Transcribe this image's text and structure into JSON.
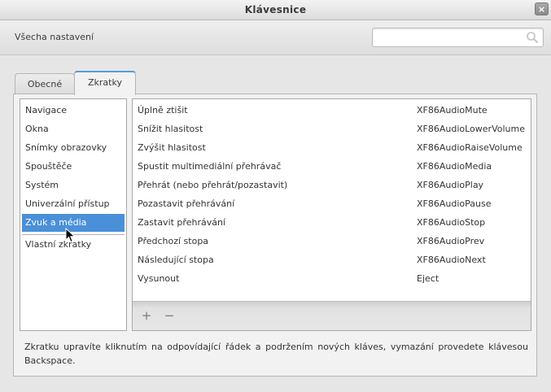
{
  "window": {
    "title": "Klávesnice",
    "close_glyph": "×"
  },
  "header": {
    "back_label": "Všecha nastavení",
    "search_placeholder": ""
  },
  "tabs": [
    {
      "label": "Obecné"
    },
    {
      "label": "Zkratky"
    }
  ],
  "categories": [
    {
      "label": "Navigace"
    },
    {
      "label": "Okna"
    },
    {
      "label": "Snímky obrazovky"
    },
    {
      "label": "Spouštěče"
    },
    {
      "label": "Systém"
    },
    {
      "label": "Univerzální přístup"
    },
    {
      "label": "Zvuk a média"
    },
    {
      "label": "Vlastní zkratky"
    }
  ],
  "selected_category": "Zvuk a média",
  "shortcuts": [
    {
      "name": "Úplně ztišit",
      "key": "XF86AudioMute"
    },
    {
      "name": "Snížit hlasitost",
      "key": "XF86AudioLowerVolume"
    },
    {
      "name": "Zvýšit hlasitost",
      "key": "XF86AudioRaiseVolume"
    },
    {
      "name": "Spustit multimediální přehrávač",
      "key": "XF86AudioMedia"
    },
    {
      "name": "Přehrát (nebo přehrát/pozastavit)",
      "key": "XF86AudioPlay"
    },
    {
      "name": "Pozastavit přehrávání",
      "key": "XF86AudioPause"
    },
    {
      "name": "Zastavit přehrávání",
      "key": "XF86AudioStop"
    },
    {
      "name": "Předchozí stopa",
      "key": "XF86AudioPrev"
    },
    {
      "name": "Následující stopa",
      "key": "XF86AudioNext"
    },
    {
      "name": "Vysunout",
      "key": "Eject"
    }
  ],
  "toolbar": {
    "add_label": "+",
    "remove_label": "−"
  },
  "hint": "Zkratku upravíte kliknutím na odpovídající řádek a podržením nových kláves, vymazání provedete klávesou Backspace.",
  "colors": {
    "selection": "#4a90d9",
    "tab_accent": "#5b9ad5",
    "background": "#e6e6e6"
  },
  "icons": {
    "search": "search-icon",
    "close": "close-icon",
    "cursor": "mouse-pointer-icon"
  }
}
